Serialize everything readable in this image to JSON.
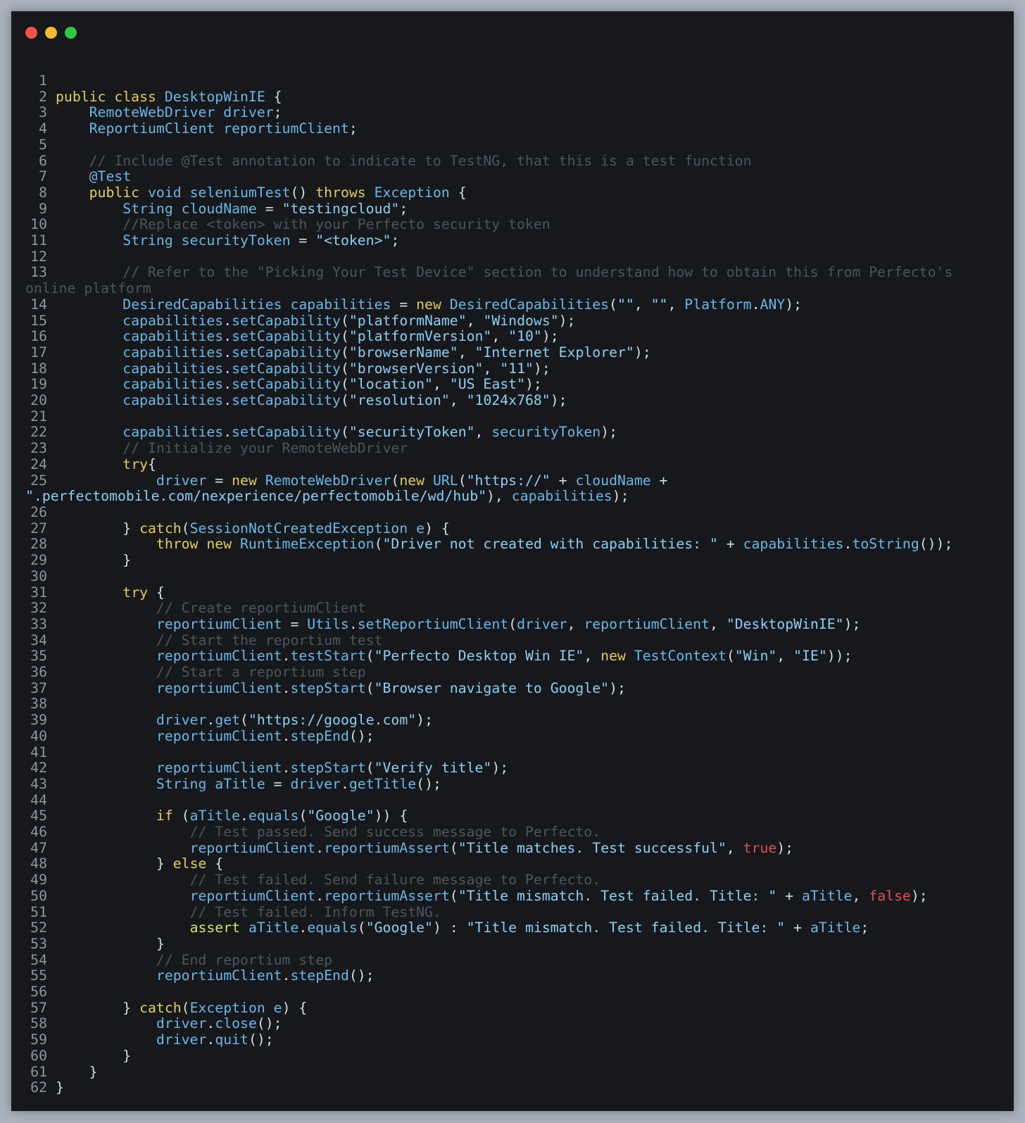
{
  "window": {
    "dots": [
      {
        "name": "close",
        "color": "#f2544b"
      },
      {
        "name": "minimize",
        "color": "#f7b92b"
      },
      {
        "name": "maximize",
        "color": "#2ec944"
      }
    ]
  },
  "colors": {
    "background": "#16181c",
    "keyword": "#e6cc5c",
    "identifier": "#6cb8e6",
    "string": "#8fd0f4",
    "comment": "#4b5561",
    "boolean": "#e05252"
  },
  "code_lines": [
    [],
    [
      [
        "kw",
        "public class "
      ],
      [
        "ty",
        "DesktopWinIE"
      ],
      [
        "pun",
        " {"
      ]
    ],
    [
      [
        "pun",
        "    "
      ],
      [
        "ty",
        "RemoteWebDriver"
      ],
      [
        "id",
        " driver"
      ],
      [
        "pun",
        ";"
      ]
    ],
    [
      [
        "pun",
        "    "
      ],
      [
        "ty",
        "ReportiumClient"
      ],
      [
        "id",
        " reportiumClient"
      ],
      [
        "pun",
        ";"
      ]
    ],
    [],
    [
      [
        "com",
        "    // Include @Test annotation to indicate to TestNG, that this is a test function"
      ]
    ],
    [
      [
        "pun",
        "    "
      ],
      [
        "ann",
        "@Test"
      ]
    ],
    [
      [
        "pun",
        "    "
      ],
      [
        "kw",
        "public "
      ],
      [
        "ty",
        "void "
      ],
      [
        "id",
        "seleniumTest"
      ],
      [
        "pun",
        "() "
      ],
      [
        "kw",
        "throws "
      ],
      [
        "ty",
        "Exception"
      ],
      [
        "pun",
        " {"
      ]
    ],
    [
      [
        "pun",
        "        "
      ],
      [
        "ty",
        "String"
      ],
      [
        "id",
        " cloudName"
      ],
      [
        "pun",
        " = "
      ],
      [
        "str",
        "\"testingcloud\""
      ],
      [
        "pun",
        ";"
      ]
    ],
    [
      [
        "com",
        "        //Replace <token> with your Perfecto security token"
      ]
    ],
    [
      [
        "pun",
        "        "
      ],
      [
        "ty",
        "String"
      ],
      [
        "id",
        " securityToken"
      ],
      [
        "pun",
        " = "
      ],
      [
        "str",
        "\"<token>\""
      ],
      [
        "pun",
        ";"
      ]
    ],
    [],
    [
      [
        "com",
        "        // Refer to the \"Picking Your Test Device\" section to understand how to obtain this from Perfecto's"
      ]
    ],
    [
      [
        "pun",
        "        "
      ],
      [
        "ty",
        "DesiredCapabilities"
      ],
      [
        "id",
        " capabilities"
      ],
      [
        "pun",
        " = "
      ],
      [
        "kw",
        "new "
      ],
      [
        "ty",
        "DesiredCapabilities"
      ],
      [
        "pun",
        "("
      ],
      [
        "str",
        "\"\""
      ],
      [
        "pun",
        ", "
      ],
      [
        "str",
        "\"\""
      ],
      [
        "pun",
        ", "
      ],
      [
        "id",
        "Platform"
      ],
      [
        "pun",
        "."
      ],
      [
        "id",
        "ANY"
      ],
      [
        "pun",
        ");"
      ]
    ],
    [
      [
        "pun",
        "        "
      ],
      [
        "id",
        "capabilities"
      ],
      [
        "pun",
        "."
      ],
      [
        "id",
        "setCapability"
      ],
      [
        "pun",
        "("
      ],
      [
        "str",
        "\"platformName\""
      ],
      [
        "pun",
        ", "
      ],
      [
        "str",
        "\"Windows\""
      ],
      [
        "pun",
        ");"
      ]
    ],
    [
      [
        "pun",
        "        "
      ],
      [
        "id",
        "capabilities"
      ],
      [
        "pun",
        "."
      ],
      [
        "id",
        "setCapability"
      ],
      [
        "pun",
        "("
      ],
      [
        "str",
        "\"platformVersion\""
      ],
      [
        "pun",
        ", "
      ],
      [
        "str",
        "\"10\""
      ],
      [
        "pun",
        ");"
      ]
    ],
    [
      [
        "pun",
        "        "
      ],
      [
        "id",
        "capabilities"
      ],
      [
        "pun",
        "."
      ],
      [
        "id",
        "setCapability"
      ],
      [
        "pun",
        "("
      ],
      [
        "str",
        "\"browserName\""
      ],
      [
        "pun",
        ", "
      ],
      [
        "str",
        "\"Internet Explorer\""
      ],
      [
        "pun",
        ");"
      ]
    ],
    [
      [
        "pun",
        "        "
      ],
      [
        "id",
        "capabilities"
      ],
      [
        "pun",
        "."
      ],
      [
        "id",
        "setCapability"
      ],
      [
        "pun",
        "("
      ],
      [
        "str",
        "\"browserVersion\""
      ],
      [
        "pun",
        ", "
      ],
      [
        "str",
        "\"11\""
      ],
      [
        "pun",
        ");"
      ]
    ],
    [
      [
        "pun",
        "        "
      ],
      [
        "id",
        "capabilities"
      ],
      [
        "pun",
        "."
      ],
      [
        "id",
        "setCapability"
      ],
      [
        "pun",
        "("
      ],
      [
        "str",
        "\"location\""
      ],
      [
        "pun",
        ", "
      ],
      [
        "str",
        "\"US East\""
      ],
      [
        "pun",
        ");"
      ]
    ],
    [
      [
        "pun",
        "        "
      ],
      [
        "id",
        "capabilities"
      ],
      [
        "pun",
        "."
      ],
      [
        "id",
        "setCapability"
      ],
      [
        "pun",
        "("
      ],
      [
        "str",
        "\"resolution\""
      ],
      [
        "pun",
        ", "
      ],
      [
        "str",
        "\"1024x768\""
      ],
      [
        "pun",
        ");"
      ]
    ],
    [],
    [
      [
        "pun",
        "        "
      ],
      [
        "id",
        "capabilities"
      ],
      [
        "pun",
        "."
      ],
      [
        "id",
        "setCapability"
      ],
      [
        "pun",
        "("
      ],
      [
        "str",
        "\"securityToken\""
      ],
      [
        "pun",
        ", "
      ],
      [
        "id",
        "securityToken"
      ],
      [
        "pun",
        ");"
      ]
    ],
    [
      [
        "com",
        "        // Initialize your RemoteWebDriver"
      ]
    ],
    [
      [
        "pun",
        "        "
      ],
      [
        "kw",
        "try"
      ],
      [
        "pun",
        "{"
      ]
    ],
    [
      [
        "pun",
        "            "
      ],
      [
        "id",
        "driver"
      ],
      [
        "pun",
        " = "
      ],
      [
        "kw",
        "new "
      ],
      [
        "ty",
        "RemoteWebDriver"
      ],
      [
        "pun",
        "("
      ],
      [
        "kw",
        "new "
      ],
      [
        "ty",
        "URL"
      ],
      [
        "pun",
        "("
      ],
      [
        "str",
        "\"https://\""
      ],
      [
        "pun",
        " + "
      ],
      [
        "id",
        "cloudName"
      ],
      [
        "pun",
        " +"
      ]
    ],
    [],
    [
      [
        "pun",
        "        } "
      ],
      [
        "kw",
        "catch"
      ],
      [
        "pun",
        "("
      ],
      [
        "ty",
        "SessionNotCreatedException"
      ],
      [
        "id",
        " e"
      ],
      [
        "pun",
        ") {"
      ]
    ],
    [
      [
        "pun",
        "            "
      ],
      [
        "kw",
        "throw new "
      ],
      [
        "ty",
        "RuntimeException"
      ],
      [
        "pun",
        "("
      ],
      [
        "str",
        "\"Driver not created with capabilities: \""
      ],
      [
        "pun",
        " + "
      ],
      [
        "id",
        "capabilities"
      ],
      [
        "pun",
        "."
      ],
      [
        "id",
        "toString"
      ],
      [
        "pun",
        "());"
      ]
    ],
    [
      [
        "pun",
        "        }"
      ]
    ],
    [],
    [
      [
        "pun",
        "        "
      ],
      [
        "kw",
        "try"
      ],
      [
        "pun",
        " {"
      ]
    ],
    [
      [
        "com",
        "            // Create reportiumClient"
      ]
    ],
    [
      [
        "pun",
        "            "
      ],
      [
        "id",
        "reportiumClient"
      ],
      [
        "pun",
        " = "
      ],
      [
        "id",
        "Utils"
      ],
      [
        "pun",
        "."
      ],
      [
        "id",
        "setReportiumClient"
      ],
      [
        "pun",
        "("
      ],
      [
        "id",
        "driver"
      ],
      [
        "pun",
        ", "
      ],
      [
        "id",
        "reportiumClient"
      ],
      [
        "pun",
        ", "
      ],
      [
        "str",
        "\"DesktopWinIE\""
      ],
      [
        "pun",
        ");"
      ]
    ],
    [
      [
        "com",
        "            // Start the reportium test"
      ]
    ],
    [
      [
        "pun",
        "            "
      ],
      [
        "id",
        "reportiumClient"
      ],
      [
        "pun",
        "."
      ],
      [
        "id",
        "testStart"
      ],
      [
        "pun",
        "("
      ],
      [
        "str",
        "\"Perfecto Desktop Win IE\""
      ],
      [
        "pun",
        ", "
      ],
      [
        "kw",
        "new "
      ],
      [
        "ty",
        "TestContext"
      ],
      [
        "pun",
        "("
      ],
      [
        "str",
        "\"Win\""
      ],
      [
        "pun",
        ", "
      ],
      [
        "str",
        "\"IE\""
      ],
      [
        "pun",
        "));"
      ]
    ],
    [
      [
        "com",
        "            // Start a reportium step"
      ]
    ],
    [
      [
        "pun",
        "            "
      ],
      [
        "id",
        "reportiumClient"
      ],
      [
        "pun",
        "."
      ],
      [
        "id",
        "stepStart"
      ],
      [
        "pun",
        "("
      ],
      [
        "str",
        "\"Browser navigate to Google\""
      ],
      [
        "pun",
        ");"
      ]
    ],
    [],
    [
      [
        "pun",
        "            "
      ],
      [
        "id",
        "driver"
      ],
      [
        "pun",
        "."
      ],
      [
        "id",
        "get"
      ],
      [
        "pun",
        "("
      ],
      [
        "str",
        "\"https://google.com\""
      ],
      [
        "pun",
        ");"
      ]
    ],
    [
      [
        "pun",
        "            "
      ],
      [
        "id",
        "reportiumClient"
      ],
      [
        "pun",
        "."
      ],
      [
        "id",
        "stepEnd"
      ],
      [
        "pun",
        "();"
      ]
    ],
    [],
    [
      [
        "pun",
        "            "
      ],
      [
        "id",
        "reportiumClient"
      ],
      [
        "pun",
        "."
      ],
      [
        "id",
        "stepStart"
      ],
      [
        "pun",
        "("
      ],
      [
        "str",
        "\"Verify title\""
      ],
      [
        "pun",
        ");"
      ]
    ],
    [
      [
        "pun",
        "            "
      ],
      [
        "ty",
        "String"
      ],
      [
        "id",
        " aTitle"
      ],
      [
        "pun",
        " = "
      ],
      [
        "id",
        "driver"
      ],
      [
        "pun",
        "."
      ],
      [
        "id",
        "getTitle"
      ],
      [
        "pun",
        "();"
      ]
    ],
    [],
    [
      [
        "pun",
        "            "
      ],
      [
        "kw",
        "if"
      ],
      [
        "pun",
        " ("
      ],
      [
        "id",
        "aTitle"
      ],
      [
        "pun",
        "."
      ],
      [
        "id",
        "equals"
      ],
      [
        "pun",
        "("
      ],
      [
        "str",
        "\"Google\""
      ],
      [
        "pun",
        ")) {"
      ]
    ],
    [
      [
        "com",
        "                // Test passed. Send success message to Perfecto."
      ]
    ],
    [
      [
        "pun",
        "                "
      ],
      [
        "id",
        "reportiumClient"
      ],
      [
        "pun",
        "."
      ],
      [
        "id",
        "reportiumAssert"
      ],
      [
        "pun",
        "("
      ],
      [
        "str",
        "\"Title matches. Test successful\""
      ],
      [
        "pun",
        ", "
      ],
      [
        "bool",
        "true"
      ],
      [
        "pun",
        ");"
      ]
    ],
    [
      [
        "pun",
        "            } "
      ],
      [
        "kw",
        "else"
      ],
      [
        "pun",
        " {"
      ]
    ],
    [
      [
        "com",
        "                // Test failed. Send failure message to Perfecto."
      ]
    ],
    [
      [
        "pun",
        "                "
      ],
      [
        "id",
        "reportiumClient"
      ],
      [
        "pun",
        "."
      ],
      [
        "id",
        "reportiumAssert"
      ],
      [
        "pun",
        "("
      ],
      [
        "str",
        "\"Title mismatch. Test failed. Title: \""
      ],
      [
        "pun",
        " + "
      ],
      [
        "id",
        "aTitle"
      ],
      [
        "pun",
        ", "
      ],
      [
        "bool",
        "false"
      ],
      [
        "pun",
        ");"
      ]
    ],
    [
      [
        "com",
        "                // Test failed. Inform TestNG."
      ]
    ],
    [
      [
        "pun",
        "                "
      ],
      [
        "as",
        "assert "
      ],
      [
        "id",
        "aTitle"
      ],
      [
        "pun",
        "."
      ],
      [
        "id",
        "equals"
      ],
      [
        "pun",
        "("
      ],
      [
        "str",
        "\"Google\""
      ],
      [
        "pun",
        ") : "
      ],
      [
        "str",
        "\"Title mismatch. Test failed. Title: \""
      ],
      [
        "pun",
        " + "
      ],
      [
        "id",
        "aTitle"
      ],
      [
        "pun",
        ";"
      ]
    ],
    [
      [
        "pun",
        "            }"
      ]
    ],
    [
      [
        "com",
        "            // End reportium step"
      ]
    ],
    [
      [
        "pun",
        "            "
      ],
      [
        "id",
        "reportiumClient"
      ],
      [
        "pun",
        "."
      ],
      [
        "id",
        "stepEnd"
      ],
      [
        "pun",
        "();"
      ]
    ],
    [],
    [
      [
        "pun",
        "        } "
      ],
      [
        "kw",
        "catch"
      ],
      [
        "pun",
        "("
      ],
      [
        "ty",
        "Exception"
      ],
      [
        "id",
        " e"
      ],
      [
        "pun",
        ") {"
      ]
    ],
    [
      [
        "pun",
        "            "
      ],
      [
        "id",
        "driver"
      ],
      [
        "pun",
        "."
      ],
      [
        "id",
        "close"
      ],
      [
        "pun",
        "();"
      ]
    ],
    [
      [
        "pun",
        "            "
      ],
      [
        "id",
        "driver"
      ],
      [
        "pun",
        "."
      ],
      [
        "id",
        "quit"
      ],
      [
        "pun",
        "();"
      ]
    ],
    [
      [
        "pun",
        "        }"
      ]
    ],
    [
      [
        "pun",
        "    }"
      ]
    ],
    [
      [
        "pun",
        "}"
      ]
    ]
  ],
  "wrapped": {
    "13": [
      [
        "com",
        "online platform"
      ]
    ],
    "25": [
      [
        "str",
        "\".perfectomobile.com/nexperience/perfectomobile/wd/hub\""
      ],
      [
        "pun",
        "), "
      ],
      [
        "id",
        "capabilities"
      ],
      [
        "pun",
        ");"
      ]
    ]
  }
}
